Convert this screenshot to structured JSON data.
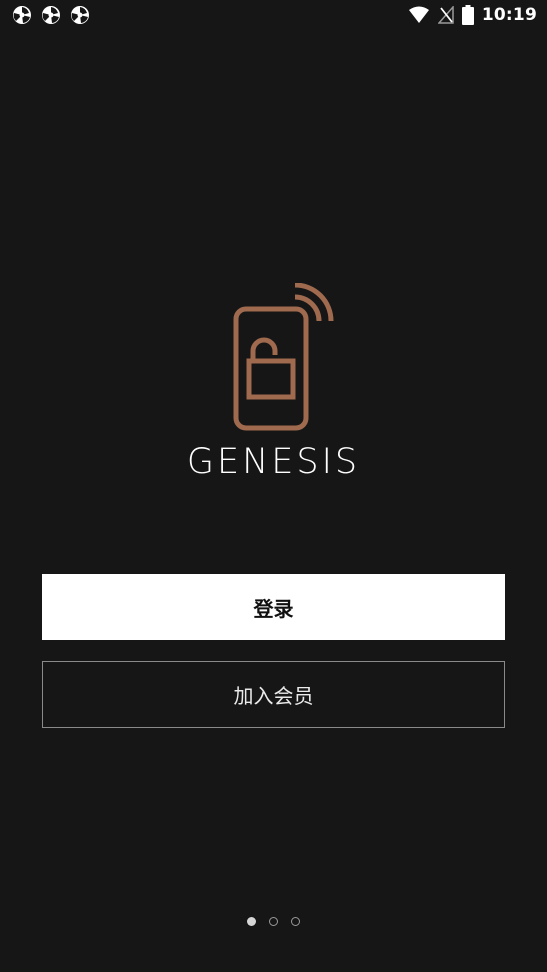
{
  "status_bar": {
    "time": "10:19",
    "left_icons": [
      "app-notification-icon",
      "app-notification-icon",
      "app-notification-icon"
    ],
    "right_icons": [
      "wifi-icon",
      "no-signal-icon",
      "battery-icon"
    ]
  },
  "logo": {
    "icon": "phone-unlock-logo-icon",
    "brand": "GENESIS",
    "accent_color": "#a06a4f"
  },
  "buttons": {
    "login_label": "登录",
    "join_label": "加入会员"
  },
  "pager": {
    "count": 3,
    "active_index": 0
  },
  "colors": {
    "background": "#161616",
    "login_bg": "#ffffff",
    "join_border": "#8a8a8a"
  }
}
